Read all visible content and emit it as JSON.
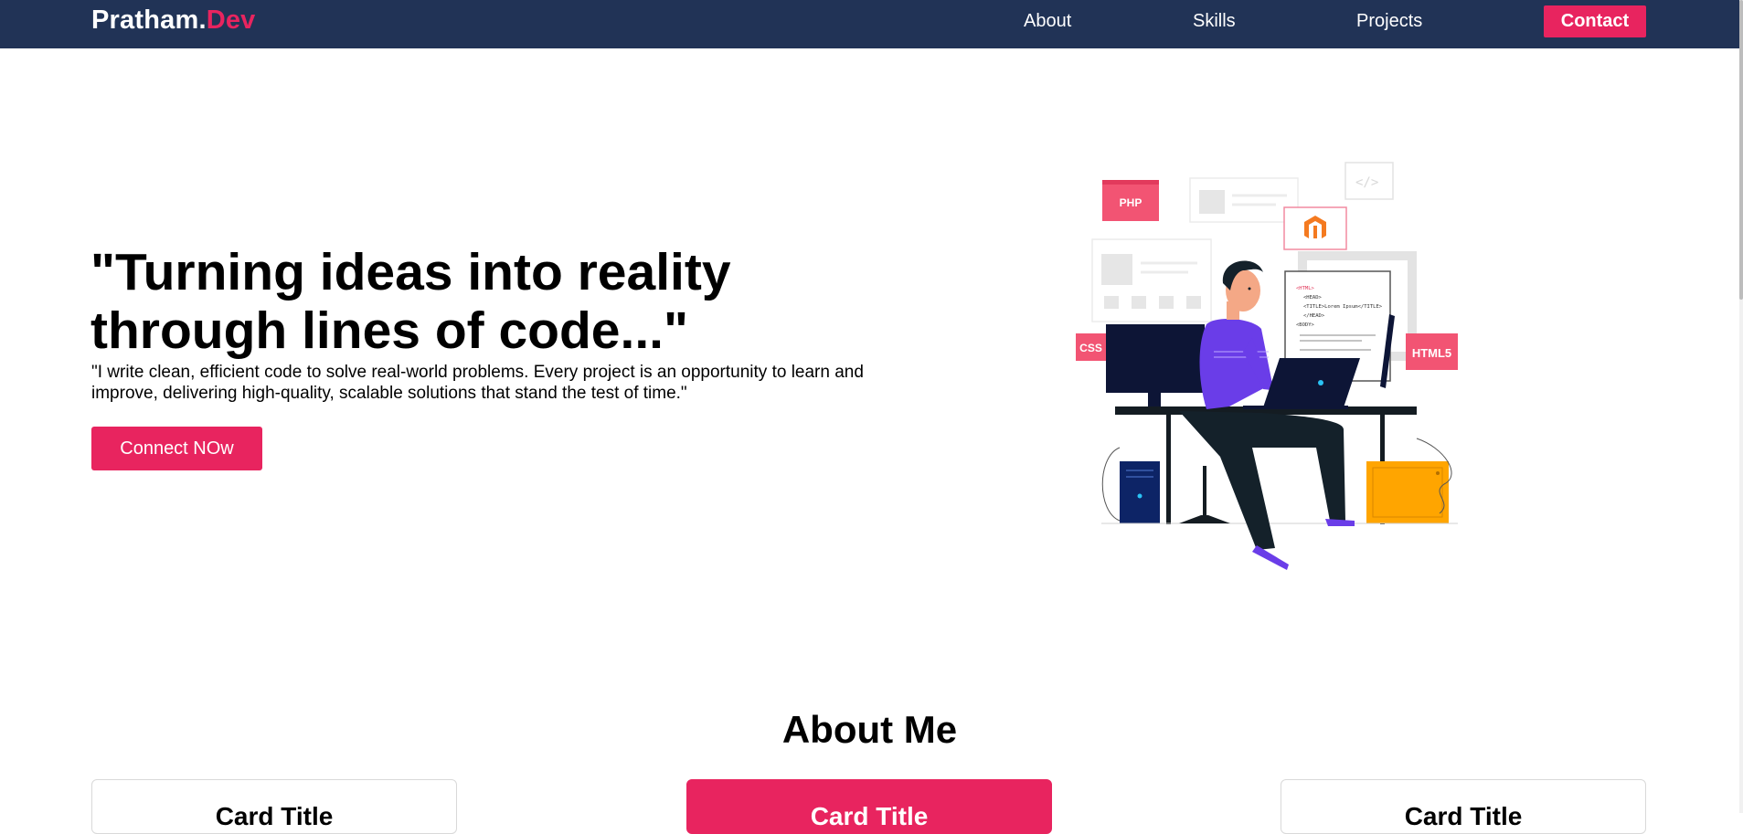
{
  "nav": {
    "brand_main": "Pratham.",
    "brand_accent": "Dev",
    "links": [
      "About",
      "Skills",
      "Projects"
    ],
    "contact_label": "Contact"
  },
  "hero": {
    "title_line1": "\"Turning ideas into reality",
    "title_line2": "through lines of code...\"",
    "text": "\"I write clean, efficient code to solve real-world problems. Every project is an opportunity to learn and improve, delivering high-quality, scalable solutions that stand the test of time.\"",
    "button_label": "Connect NOw",
    "illustration": {
      "badges": [
        "PHP",
        "CSS",
        "HTML5"
      ],
      "code_lines": [
        "<HTML>",
        "<HEAD>",
        "<TITLE>Lorem Ipsum</TITLE>",
        "</HEAD>",
        "<BODY>"
      ]
    }
  },
  "about": {
    "title": "About Me",
    "cards": [
      "Card Title",
      "Card Title",
      "Card Title"
    ]
  },
  "colors": {
    "nav_bg": "#213356",
    "accent": "#e8245f",
    "person_shirt": "#6a3de8",
    "cabinet": "#ffa500"
  }
}
